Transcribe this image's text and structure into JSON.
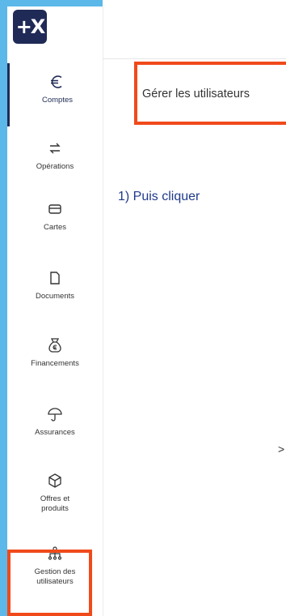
{
  "logo": {
    "text": "+X"
  },
  "sidebar": {
    "items": [
      {
        "label": "Comptes",
        "icon": "euro-icon"
      },
      {
        "label": "Opérations",
        "icon": "transfer-arrows-icon"
      },
      {
        "label": "Cartes",
        "icon": "card-icon"
      },
      {
        "label": "Documents",
        "icon": "document-icon"
      },
      {
        "label": "Financements",
        "icon": "money-bag-icon"
      },
      {
        "label": "Assurances",
        "icon": "umbrella-icon"
      },
      {
        "label": "Offres et produits",
        "icon": "cube-icon"
      },
      {
        "label": "Gestion des utilisateurs",
        "icon": "org-chart-icon"
      }
    ]
  },
  "main": {
    "manage_users_label": "Gérer les utilisateurs",
    "instruction": "1)   Puis cliquer",
    "chevron": ">"
  },
  "colors": {
    "accent": "#1f2a56",
    "highlight": "#f04a1a",
    "edge_blue": "#5bb8e8",
    "instruction_text": "#1f3a8a"
  }
}
